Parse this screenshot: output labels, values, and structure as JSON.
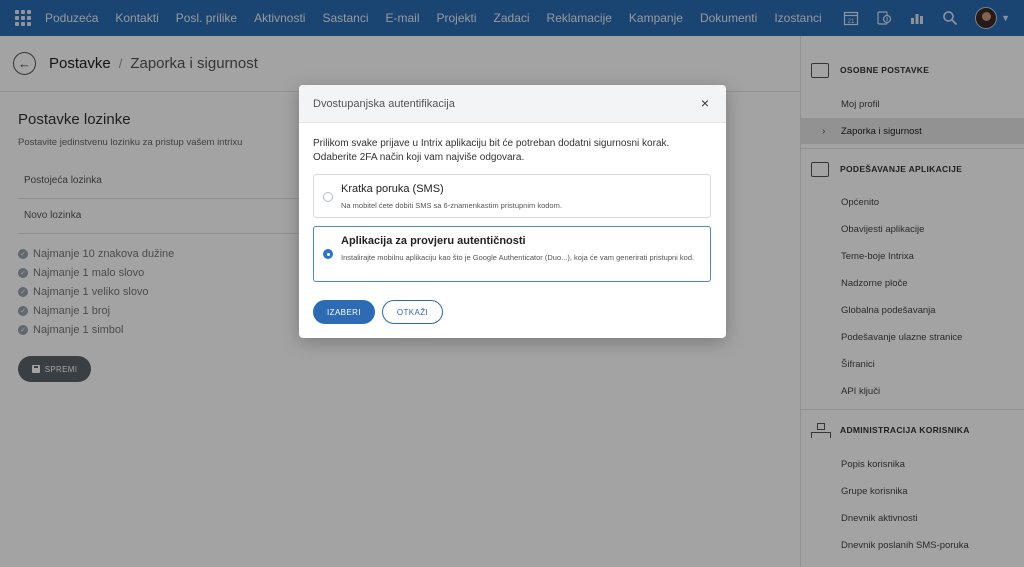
{
  "topnav": {
    "items": [
      "Poduzeća",
      "Kontakti",
      "Posl. prilike",
      "Aktivnosti",
      "Sastanci",
      "E-mail",
      "Projekti",
      "Zadaci",
      "Reklamacije",
      "Kampanje",
      "Dokumenti",
      "Izostanci"
    ],
    "calendar_day": "21"
  },
  "header": {
    "crumb_parent": "Postavke",
    "crumb_separator": "/",
    "crumb_current": "Zaporka i sigurnost"
  },
  "main": {
    "title": "Postavke lozinke",
    "subtitle": "Postavite jedinstvenu lozinku za pristup vašem intrixu",
    "fields": [
      "Postojeća lozinka",
      "Novo lozinka"
    ],
    "requirements": [
      "Najmanje 10 znakova dužine",
      "Najmanje 1 malo slovo",
      "Najmanje 1 veliko slovo",
      "Najmanje 1 broj",
      "Najmanje 1 simbol"
    ],
    "save_label": "SPREMI"
  },
  "sidebar": {
    "groups": [
      {
        "label": "OSOBNE POSTAVKE",
        "items": [
          "Moj profil",
          "Zaporka i sigurnost"
        ]
      },
      {
        "label": "PODEŠAVANJE APLIKACIJE",
        "items": [
          "Općenito",
          "Obavijesti aplikacije",
          "Teme-boje Intrixa",
          "Nadzorne ploče",
          "Globalna podešavanja",
          "Podešavanje ulazne stranice",
          "Šifranici",
          "API ključi"
        ]
      },
      {
        "label": "ADMINISTRACIJA KORISNIKA",
        "items": [
          "Popis korisnika",
          "Grupe korisnika",
          "Dnevnik aktivnosti",
          "Dnevnik poslanih SMS-poruka"
        ]
      }
    ]
  },
  "modal": {
    "title": "Dvostupanjska autentifikacija",
    "close": "×",
    "desc_line1": "Prilikom svake prijave u Intrix aplikaciju bit će potreban dodatni sigurnosni korak.",
    "desc_line2": "Odaberite 2FA način koji vam najviše odgovara.",
    "options": [
      {
        "title": "Kratka poruka (SMS)",
        "desc": "Na mobitel ćete dobiti SMS sa 6-znamenkastim pristupnim kodom.",
        "selected": false
      },
      {
        "title": "Aplikacija za provjeru autentičnosti",
        "desc": "Instalirajte mobilnu aplikaciju kao što je Google Authenticator (Duo...), koja će vam generirati pristupni kod.",
        "selected": true
      }
    ],
    "confirm_label": "IZABERI",
    "cancel_label": "OTKAŽI"
  },
  "colors": {
    "nav_bg": "#2a6db3",
    "primary": "#2d6bb5",
    "overlay": "rgba(0,0,0,0.36)"
  }
}
